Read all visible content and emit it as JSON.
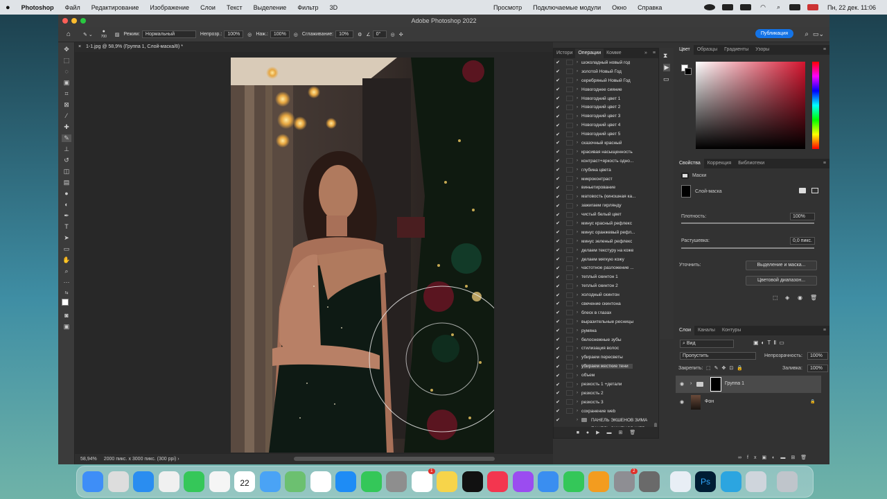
{
  "menubar": {
    "app": "Photoshop",
    "items": [
      "Файл",
      "Редактирование",
      "Изображение",
      "Слои",
      "Текст",
      "Выделение",
      "Фильтр",
      "3D"
    ],
    "right_items": [
      "Просмотр",
      "Подключаемые модули",
      "Окно",
      "Справка"
    ],
    "datetime": "Пн, 22 дек.  11:06"
  },
  "window": {
    "title": "Adobe Photoshop 2022"
  },
  "options": {
    "brush_size": "700",
    "mode_label": "Режим:",
    "mode": "Нормальный",
    "opacity_label": "Непрозр.:",
    "opacity": "100%",
    "flow_label": "Наж.:",
    "flow": "100%",
    "smoothing_label": "Сглаживание:",
    "smoothing": "10%",
    "angle": "0°",
    "publish": "Публикация"
  },
  "document": {
    "tab": "1-1.jpg @ 58,9% (Группа 1, Слой-маска/8) *",
    "zoom": "58,94%",
    "info": "2000 пикс. x 3000 пикс. (300 ppi)"
  },
  "actions_panel": {
    "tabs": [
      "Истори",
      "Операции",
      "Комме"
    ],
    "items": [
      "шоколадный новый год",
      "золотой Новый Год",
      "серебряный Новый Год",
      "Новогоднее сияние",
      "Новогодний цвет 1",
      "Новогодний цвет 2",
      "Новогодний цвет 3",
      "Новогодний цвет 4",
      "Новогодний цвет 5",
      "сказочный красный",
      "красивая насыщенность",
      "контраст+яркость одно...",
      "глубина цвета",
      "микроконтраст",
      "виньетирование",
      "матовость (киношная ка...",
      "зажигаем гирлянду",
      "чистый белый цвет",
      "минус красный рефлекс",
      "минус оранжевый рефл...",
      "минус зеленый рефлекс",
      "делаем текстуру на коже",
      "делаем мягкую кожу",
      "частотное разложение ...",
      "теплый скинтон 1",
      "теплый скинтон 2",
      "холодный скинтон",
      "свечение скинтона",
      "блеск в глазах",
      "выразительные ресницы",
      "румяна",
      "белоснежные зубы",
      "стилизация волос",
      "убираем пересветы",
      "убираем жесткие тени",
      "объем",
      "резкость 1 +детали",
      "резкость 2",
      "резкость 3",
      "сохранение web"
    ],
    "selected_index": 34,
    "folders": [
      "ПАНЕЛЬ ЭКШЕНОВ ЗИМА",
      "ПАНЕЛЬ ЭКШЕНОВ WEB"
    ]
  },
  "color_panel": {
    "tabs": [
      "Цвет",
      "Образцы",
      "Градиенты",
      "Узоры"
    ],
    "base_color": "#d4142e"
  },
  "properties": {
    "tabs": [
      "Свойства",
      "Коррекция",
      "Библиотеки"
    ],
    "section": "Маски",
    "mask_name": "Слой-маска",
    "density_label": "Плотность:",
    "density": "100%",
    "feather_label": "Растушевка:",
    "feather": "0,0 пикс.",
    "refine_label": "Уточнить:",
    "select_mask": "Выделение и маска...",
    "color_range": "Цветовой диапазон..."
  },
  "layers": {
    "tabs": [
      "Слои",
      "Каналы",
      "Контуры"
    ],
    "filter": "Вид",
    "blend": "Пропустить",
    "opacity_label": "Непрозрачность:",
    "opacity": "100%",
    "lock_label": "Закрепить:",
    "fill_label": "Заливка:",
    "fill": "100%",
    "items": [
      {
        "name": "Группа 1"
      },
      {
        "name": "Фон"
      }
    ]
  },
  "dock": {
    "calendar_day": "22",
    "badges": {
      "reminders": "1",
      "settings": "2"
    },
    "apps": [
      "finder-icon",
      "launchpad-icon",
      "safari-icon",
      "yandex-icon",
      "messages-icon",
      "chrome-icon",
      "calendar-icon",
      "mail-icon",
      "maps-icon",
      "photos-icon",
      "appstore-icon",
      "facetime-icon",
      "contacts-icon",
      "reminders-icon",
      "notes-icon",
      "appletv-icon",
      "music-icon",
      "podcasts-icon",
      "keynote-icon",
      "numbers-icon",
      "pages-icon",
      "settings-icon",
      "iphone-mirroring-icon",
      "quicktime-icon",
      "photoshop-icon",
      "telegram-icon",
      "diskutility-icon",
      "trash-icon"
    ]
  }
}
